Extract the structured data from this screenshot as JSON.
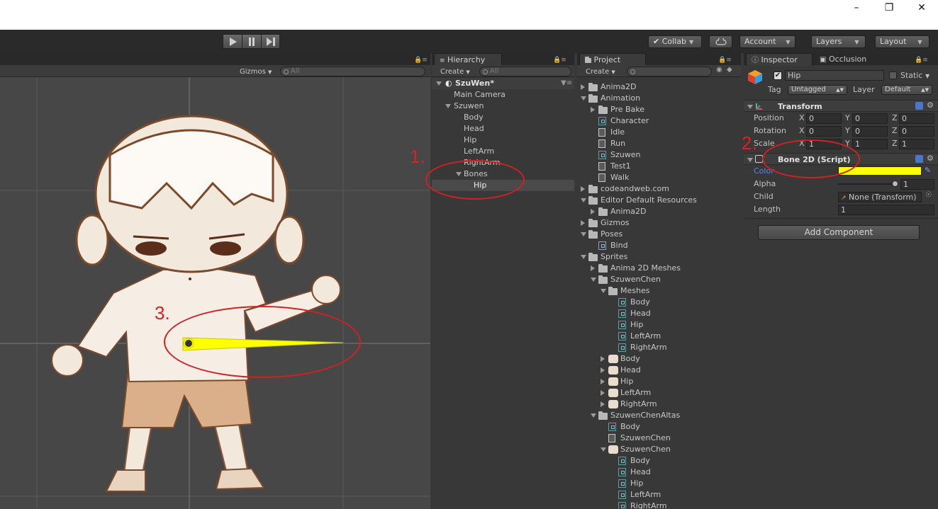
{
  "toolbar": {
    "collab": "Collab",
    "account": "Account",
    "layers": "Layers",
    "layout": "Layout"
  },
  "scene": {
    "gizmos": "Gizmos",
    "search_placeholder": "All"
  },
  "hierarchy": {
    "tab": "Hierarchy",
    "create": "Create",
    "search_placeholder": "All",
    "scene_name": "SzuWen*",
    "items": [
      "Main Camera",
      "Szuwen",
      "Body",
      "Head",
      "Hip",
      "LeftArm",
      "RightArm",
      "Bones",
      "Hip"
    ]
  },
  "project": {
    "tab": "Project",
    "create": "Create",
    "items": [
      "Anima2D",
      "Animation",
      "Pre Bake",
      "Character",
      "Idle",
      "Run",
      "Szuwen",
      "Test1",
      "Walk",
      "codeandweb.com",
      "Editor Default Resources",
      "Anima2D",
      "Gizmos",
      "Poses",
      "Bind",
      "Sprites",
      "Anima 2D Meshes",
      "SzuwenChen",
      "Meshes",
      "Body",
      "Head",
      "Hip",
      "LeftArm",
      "RightArm",
      "Body",
      "Head",
      "Hip",
      "LeftArm",
      "RightArm",
      "SzuwenChenAltas",
      "Body",
      "SzuwenChen",
      "SzuwenChen",
      "Body",
      "Head",
      "Hip",
      "LeftArm",
      "RightArm"
    ]
  },
  "inspector": {
    "tab": "Inspector",
    "tab2": "Occlusion",
    "object_name": "Hip",
    "static": "Static",
    "tag_label": "Tag",
    "tag_value": "Untagged",
    "layer_label": "Layer",
    "layer_value": "Default",
    "transform": {
      "title": "Transform",
      "position_label": "Position",
      "rotation_label": "Rotation",
      "scale_label": "Scale",
      "position": [
        "0",
        "0",
        "0"
      ],
      "rotation": [
        "0",
        "0",
        "0"
      ],
      "scale": [
        "1",
        "1",
        "1"
      ],
      "axes": [
        "X",
        "Y",
        "Z"
      ]
    },
    "bone": {
      "title": "Bone 2D (Script)",
      "color_label": "Color",
      "color_value": "#ffff00",
      "alpha_label": "Alpha",
      "alpha_value": "1",
      "alpha_fraction": 1,
      "child_label": "Child",
      "child_value": "None (Transform)",
      "length_label": "Length",
      "length_value": "1"
    },
    "add_component": "Add Component"
  },
  "annotations": [
    "1.",
    "2.",
    "3."
  ]
}
